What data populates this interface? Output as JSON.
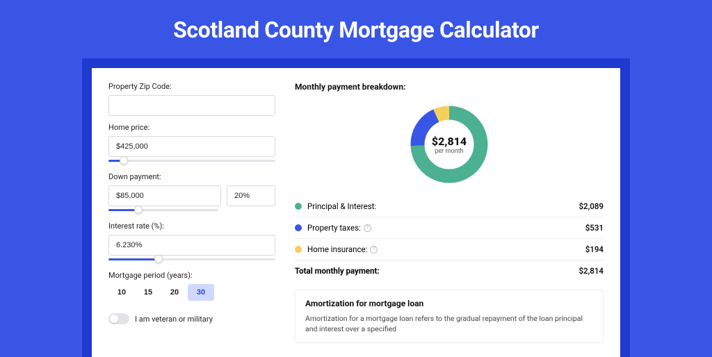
{
  "title": "Scotland County Mortgage Calculator",
  "colors": {
    "teal": "#4bb191",
    "blue": "#3855e5",
    "yellow": "#f4cf5a"
  },
  "form": {
    "zip_label": "Property Zip Code:",
    "zip_value": "",
    "price_label": "Home price:",
    "price_value": "$425,000",
    "price_slider_pct": 9,
    "down_label": "Down payment:",
    "down_value": "$85,000",
    "down_pct_value": "20%",
    "down_slider_pct": 27,
    "rate_label": "Interest rate (%):",
    "rate_value": "6.230%",
    "rate_slider_pct": 30,
    "period_label": "Mortgage period (years):",
    "periods": [
      "10",
      "15",
      "20",
      "30"
    ],
    "period_selected_index": 3,
    "veteran_label": "I am veteran or military",
    "veteran_on": false
  },
  "breakdown": {
    "heading": "Monthly payment breakdown:",
    "center_amount": "$2,814",
    "center_sub": "per month",
    "items": [
      {
        "label": "Principal & Interest:",
        "value": "$2,089",
        "color": "#4bb191",
        "info": false
      },
      {
        "label": "Property taxes:",
        "value": "$531",
        "color": "#3855e5",
        "info": true
      },
      {
        "label": "Home insurance:",
        "value": "$194",
        "color": "#f4cf5a",
        "info": true
      }
    ],
    "total_label": "Total monthly payment:",
    "total_value": "$2,814"
  },
  "amort": {
    "title": "Amortization for mortgage loan",
    "text": "Amortization for a mortgage loan refers to the gradual repayment of the loan principal and interest over a specified"
  },
  "chart_data": {
    "type": "pie",
    "title": "Monthly payment breakdown",
    "series": [
      {
        "name": "Principal & Interest",
        "value": 2089,
        "color": "#4bb191"
      },
      {
        "name": "Property taxes",
        "value": 531,
        "color": "#3855e5"
      },
      {
        "name": "Home insurance",
        "value": 194,
        "color": "#f4cf5a"
      }
    ],
    "total": 2814
  }
}
